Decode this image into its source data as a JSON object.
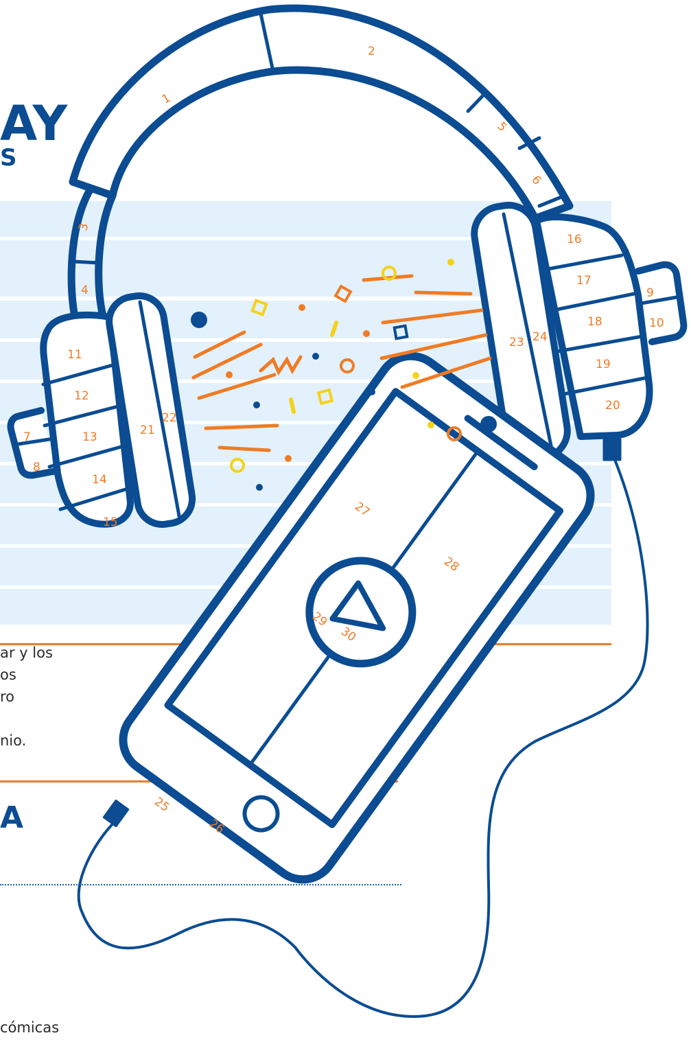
{
  "page": {
    "heading_fragment": "AY",
    "subheading_fragment": "S",
    "paragraph_lines": [
      "ar y los",
      "os",
      "ro",
      "",
      "nio."
    ],
    "lower_heading_fragment": "A",
    "footer_fragment": "cómicas"
  },
  "illustration": {
    "colors": {
      "outline": "#0b4c92",
      "label": "#f07b24",
      "accent": "#f4d21a",
      "row_fill": "#e2f1fb"
    },
    "segment_labels": [
      "1",
      "2",
      "3",
      "4",
      "5",
      "6",
      "7",
      "8",
      "9",
      "10",
      "11",
      "12",
      "13",
      "14",
      "15",
      "16",
      "17",
      "18",
      "19",
      "20",
      "21",
      "22",
      "23",
      "24",
      "25",
      "26",
      "27",
      "28",
      "29",
      "30"
    ]
  }
}
